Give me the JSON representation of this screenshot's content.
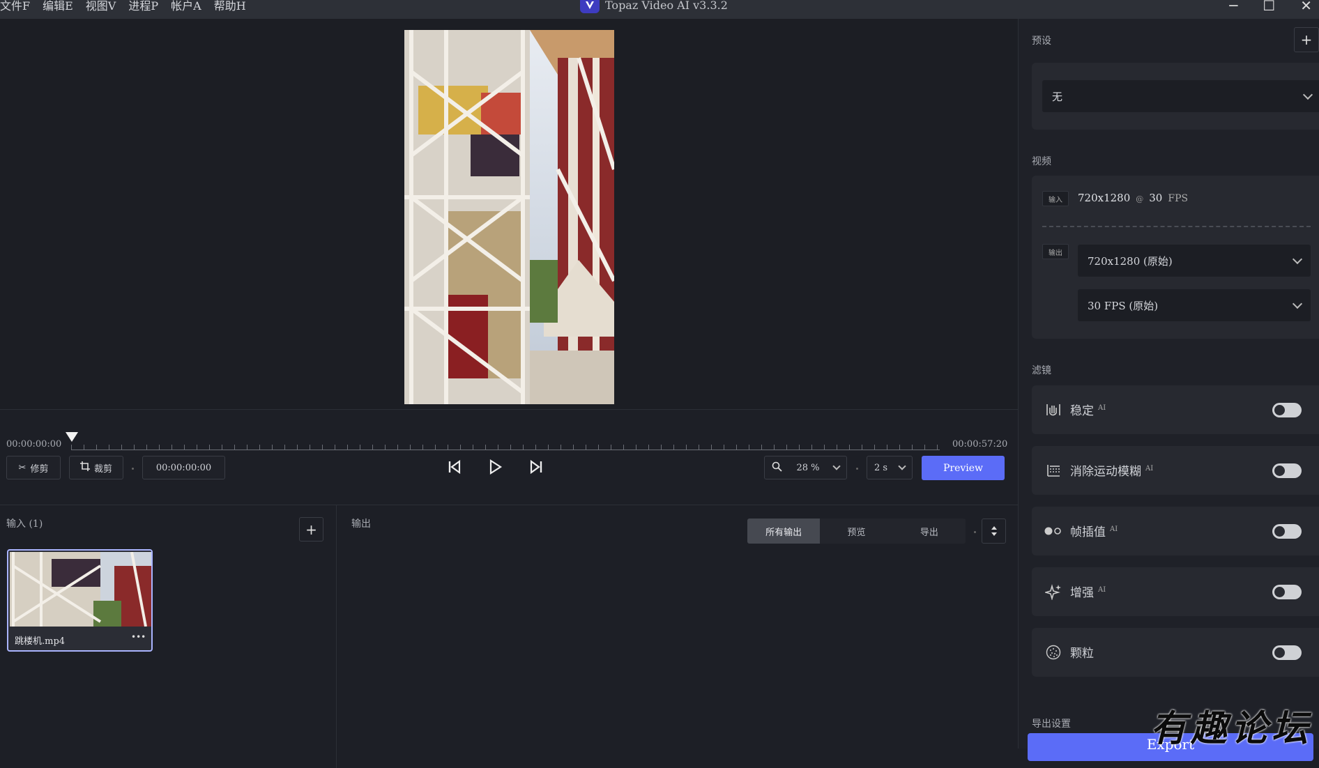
{
  "menu": [
    "文件F",
    "编辑E",
    "视图V",
    "进程P",
    "帐户A",
    "帮助H"
  ],
  "app_title": "Topaz Video AI  v3.3.2",
  "window_controls": {
    "minimize": "─",
    "maximize": "☐",
    "close": "✕"
  },
  "timeline": {
    "start": "00:00:00:00",
    "end": "00:00:57:20",
    "trim_label": "修剪",
    "crop_label": "裁剪",
    "current_time": "00:00:00:00",
    "zoom_value": "28 %",
    "step_value": "2 s",
    "preview_label": "Preview"
  },
  "inputs": {
    "title": "输入 (1)",
    "add": "+",
    "file_name": "跳楼机.mp4",
    "more": "•••"
  },
  "outputs": {
    "title": "输出",
    "tabs": [
      "所有输出",
      "预览",
      "导出"
    ],
    "active_tab": 0
  },
  "right": {
    "preset_section": "预设",
    "preset_add": "+",
    "preset_value": "无",
    "video_section": "视频",
    "input_tag": "输入",
    "input_resolution": "720x1280",
    "input_at": "@",
    "input_fps": "30",
    "input_fps_unit": "FPS",
    "output_tag": "输出",
    "output_resolution": "720x1280 (原始)",
    "output_fps": "30 FPS (原始)",
    "filters_section": "滤镜",
    "filters": [
      {
        "name": "稳定",
        "ai": "AI",
        "enabled": false,
        "icon": "stabilize-icon"
      },
      {
        "name": "消除运动模糊",
        "ai": "AI",
        "enabled": false,
        "icon": "motion-deblur-icon"
      },
      {
        "name": "帧插值",
        "ai": "AI",
        "enabled": false,
        "icon": "frame-interpolation-icon"
      },
      {
        "name": "增强",
        "ai": "AI",
        "enabled": false,
        "icon": "sparkle-icon"
      },
      {
        "name": "颗粒",
        "ai": "",
        "enabled": false,
        "icon": "grain-icon"
      }
    ],
    "export_section": "导出设置",
    "export_label": "Export"
  },
  "watermark": "有趣论坛",
  "colors": {
    "accent": "#5b6cf7",
    "background": "#1d1f26",
    "panel": "#272930"
  }
}
